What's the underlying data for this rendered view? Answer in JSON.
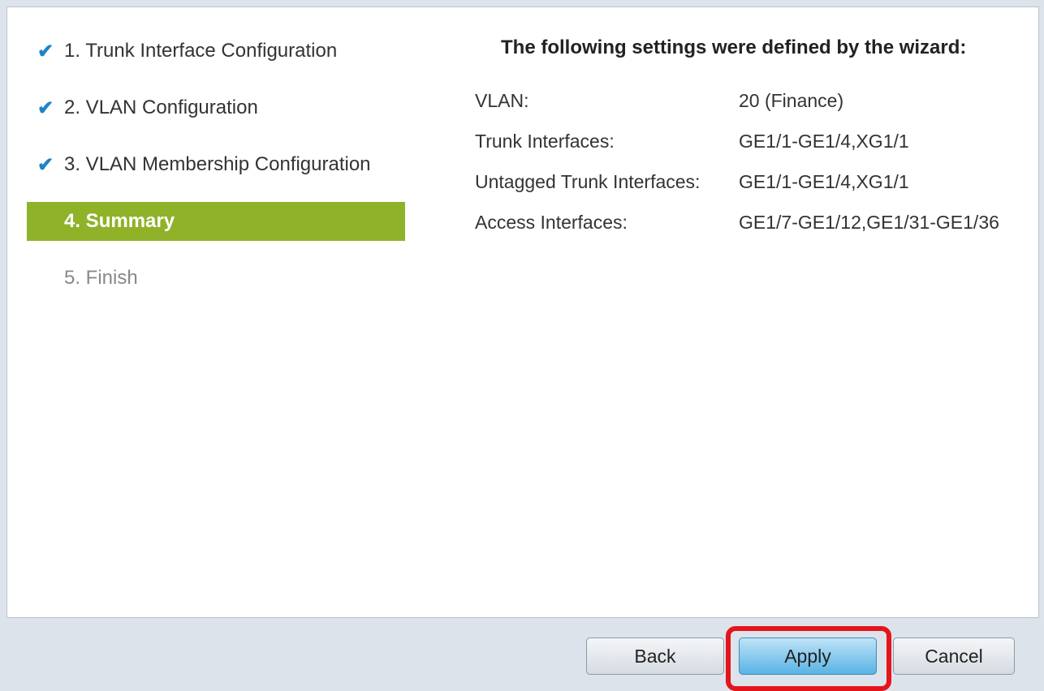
{
  "steps": [
    {
      "label": "1. Trunk Interface Configuration",
      "status": "done"
    },
    {
      "label": "2. VLAN Configuration",
      "status": "done"
    },
    {
      "label": "3. VLAN Membership Configuration",
      "status": "done"
    },
    {
      "label": "4. Summary",
      "status": "active"
    },
    {
      "label": "5. Finish",
      "status": "pending"
    }
  ],
  "check_glyph": "✔",
  "summary": {
    "title": "The following settings were defined by the wizard:",
    "rows": [
      {
        "label": "VLAN:",
        "value": "20 (Finance)"
      },
      {
        "label": "Trunk Interfaces:",
        "value": "GE1/1-GE1/4,XG1/1"
      },
      {
        "label": "Untagged Trunk Interfaces:",
        "value": "GE1/1-GE1/4,XG1/1"
      },
      {
        "label": "Access Interfaces:",
        "value": "GE1/7-GE1/12,GE1/31-GE1/36"
      }
    ]
  },
  "buttons": {
    "back": "Back",
    "apply": "Apply",
    "cancel": "Cancel"
  },
  "colors": {
    "active_step": "#8fb229",
    "check": "#1f83c6",
    "highlight": "#e4141b"
  }
}
